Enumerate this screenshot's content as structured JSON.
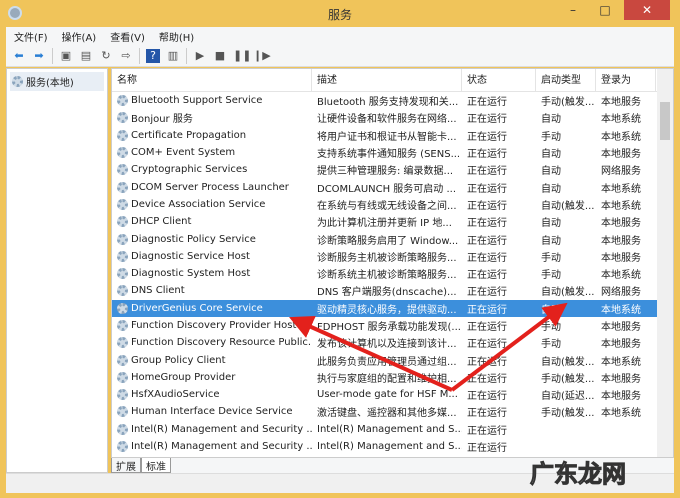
{
  "window": {
    "title": "服务",
    "minimize": "–",
    "maximize": "□",
    "close": "✕"
  },
  "menu": [
    "文件(F)",
    "操作(A)",
    "查看(V)",
    "帮助(H)"
  ],
  "toolbar_icons": [
    "back-icon",
    "forward-icon",
    "show-tree-icon",
    "properties-icon",
    "refresh-icon",
    "export-icon",
    "help-icon",
    "console-icon",
    "start-icon",
    "stop-icon",
    "pause-icon",
    "resume-icon"
  ],
  "toolbar_glyphs": [
    "⬅",
    "➡",
    "▣",
    "▤",
    "↻",
    "⇨",
    "?",
    "▥",
    "▶",
    "■",
    "❚❚",
    "❙▶"
  ],
  "tree": {
    "root": "服务(本地)"
  },
  "columns": [
    "名称",
    "描述",
    "状态",
    "启动类型",
    "登录为"
  ],
  "rows": [
    [
      "Bluetooth Support Service",
      "Bluetooth 服务支持发现和关...",
      "正在运行",
      "手动(触发...",
      "本地服务"
    ],
    [
      "Bonjour 服务",
      "让硬件设备和软件服务在网络...",
      "正在运行",
      "自动",
      "本地系统"
    ],
    [
      "Certificate Propagation",
      "将用户证书和根证书从智能卡...",
      "正在运行",
      "手动",
      "本地系统"
    ],
    [
      "COM+ Event System",
      "支持系统事件通知服务 (SENS...",
      "正在运行",
      "自动",
      "本地服务"
    ],
    [
      "Cryptographic Services",
      "提供三种管理服务: 编录数据...",
      "正在运行",
      "自动",
      "网络服务"
    ],
    [
      "DCOM Server Process Launcher",
      "DCOMLAUNCH 服务可启动 ...",
      "正在运行",
      "自动",
      "本地系统"
    ],
    [
      "Device Association Service",
      "在系统与有线或无线设备之间...",
      "正在运行",
      "自动(触发...",
      "本地系统"
    ],
    [
      "DHCP Client",
      "为此计算机注册并更新 IP 地...",
      "正在运行",
      "自动",
      "本地服务"
    ],
    [
      "Diagnostic Policy Service",
      "诊断策略服务启用了 Window...",
      "正在运行",
      "自动",
      "本地服务"
    ],
    [
      "Diagnostic Service Host",
      "诊断服务主机被诊断策略服务...",
      "正在运行",
      "手动",
      "本地服务"
    ],
    [
      "Diagnostic System Host",
      "诊断系统主机被诊断策略服务...",
      "正在运行",
      "手动",
      "本地系统"
    ],
    [
      "DNS Client",
      "DNS 客户端服务(dnscache)...",
      "正在运行",
      "自动(触发...",
      "网络服务"
    ],
    [
      "DriverGenius Core Service",
      "驱动精灵核心服务，提供驱动...",
      "正在运行",
      "自动",
      "本地系统"
    ],
    [
      "Function Discovery Provider Host",
      "FDPHOST 服务承载功能发现(...",
      "正在运行",
      "手动",
      "本地服务"
    ],
    [
      "Function Discovery Resource Public...",
      "发布该计算机以及连接到该计...",
      "正在运行",
      "手动",
      "本地服务"
    ],
    [
      "Group Policy Client",
      "此服务负责应用管理员通过组...",
      "正在运行",
      "自动(触发...",
      "本地系统"
    ],
    [
      "HomeGroup Provider",
      "执行与家庭组的配置和维护相...",
      "正在运行",
      "手动(触发...",
      "本地服务"
    ],
    [
      "HsfXAudioService",
      "User-mode gate for HSF M...",
      "正在运行",
      "自动(延迟...",
      "本地服务"
    ],
    [
      "Human Interface Device Service",
      "激活键盘、遥控器和其他多媒...",
      "正在运行",
      "手动(触发...",
      "本地系统"
    ],
    [
      "Intel(R) Management and Security ...",
      "Intel(R) Management and S...",
      "正在运行",
      "",
      ""
    ],
    [
      "Intel(R) Management and Security ...",
      "Intel(R) Management and S...",
      "正在运行",
      "",
      ""
    ]
  ],
  "selected_row": 12,
  "tabs": [
    "扩展",
    "标准"
  ],
  "watermark": "广东龙网"
}
